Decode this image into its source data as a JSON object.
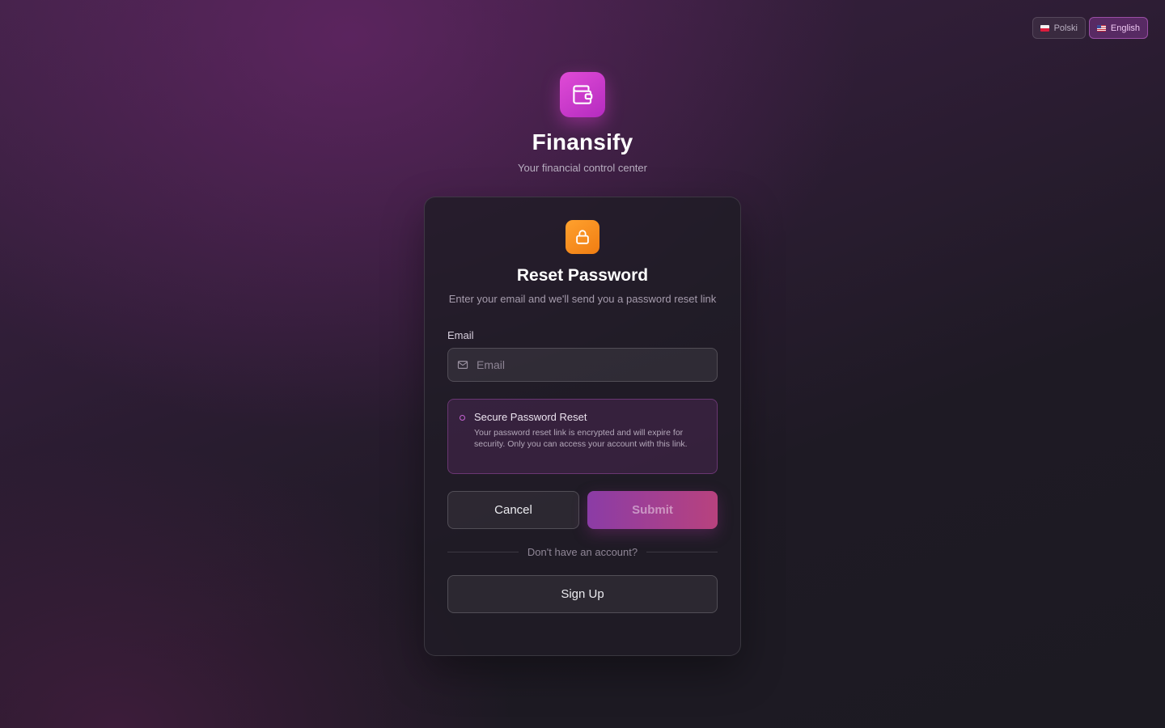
{
  "language_switcher": {
    "options": [
      {
        "label": "Polski",
        "flag": "flag-poland-icon",
        "active": false
      },
      {
        "label": "English",
        "flag": "flag-us-icon",
        "active": true
      }
    ]
  },
  "brand": {
    "logo_icon": "wallet-icon",
    "name": "Finansify",
    "tagline": "Your financial control center"
  },
  "form": {
    "icon": "lock-icon",
    "title": "Reset Password",
    "subtitle": "Enter your email and we'll send you a password reset link",
    "email": {
      "label": "Email",
      "placeholder": "Email",
      "value": "",
      "icon": "mail-icon"
    },
    "info": {
      "title": "Secure Password Reset",
      "body": "Your password reset link is encrypted and will expire for security. Only you can access your account with this link."
    },
    "cancel_label": "Cancel",
    "submit_label": "Submit",
    "divider_text": "Don't have an account?",
    "signup_label": "Sign Up"
  },
  "colors": {
    "brand_accent": "#d23fd0",
    "lock_icon_bg": "#f7901e",
    "submit_gradient_start": "#8b3ca6",
    "submit_gradient_end": "#b8427e"
  }
}
